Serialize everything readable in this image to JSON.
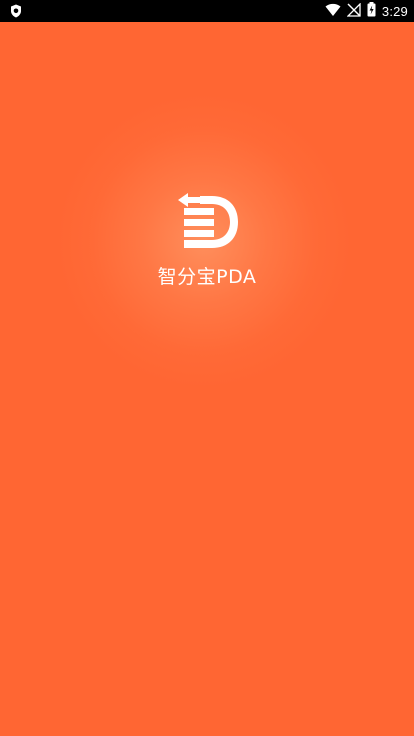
{
  "status_bar": {
    "time": "3:29",
    "left_icon": "shield-icon",
    "icons": [
      "wifi-icon",
      "no-signal-icon",
      "battery-icon"
    ]
  },
  "splash": {
    "app_name": "智分宝PDA",
    "logo_icon": "brand-logo-icon",
    "background_color": "#ff6633",
    "text_color": "#ffffff"
  }
}
